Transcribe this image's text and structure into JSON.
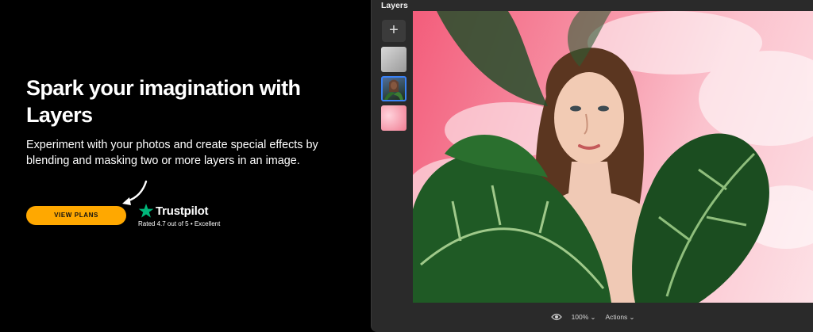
{
  "hero": {
    "title": "Spark your imagination with Layers",
    "description": "Experiment with your photos and create special effects by blending and masking two or more layers in an image.",
    "cta_label": "VIEW PLANS"
  },
  "trustpilot": {
    "name": "Trustpilot",
    "rating_text": "Rated 4.7 out of 5 • Excellent",
    "star_color": "#00b67a"
  },
  "editor": {
    "panel_title": "Layers",
    "add_label": "+",
    "layers": [
      "layer-1",
      "layer-2",
      "layer-3"
    ],
    "selected_layer": 2,
    "zoom": "100%",
    "actions_label": "Actions"
  },
  "colors": {
    "accent": "#ffa800",
    "selection": "#3a82f7",
    "background": "#000000",
    "panel": "#2a2a2a"
  }
}
